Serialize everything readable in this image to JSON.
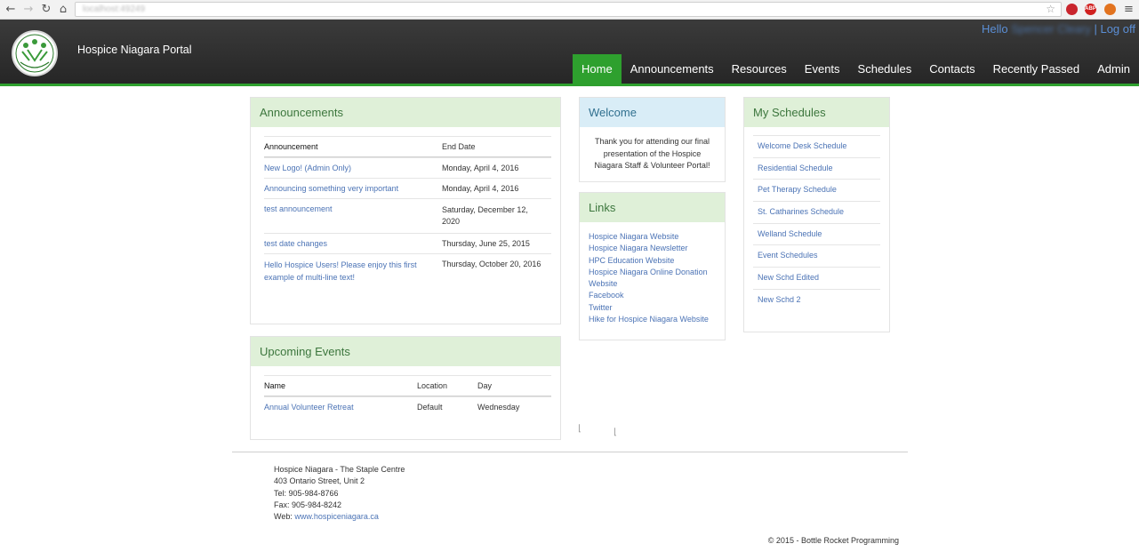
{
  "browser": {
    "url": "localhost:49249",
    "back": "←",
    "forward": "→",
    "reload": "↻",
    "home": "⌂",
    "star": "☆",
    "ext_abp": "ABP",
    "menu": "≡"
  },
  "header": {
    "site_title": "Hospice Niagara Portal",
    "hello_prefix": "Hello",
    "hello_user": "Spencer Cleary",
    "separator": "|",
    "logoff": "Log off",
    "accent": "#2ea02e"
  },
  "nav": [
    {
      "label": "Home",
      "active": true
    },
    {
      "label": "Announcements"
    },
    {
      "label": "Resources"
    },
    {
      "label": "Events"
    },
    {
      "label": "Schedules"
    },
    {
      "label": "Contacts"
    },
    {
      "label": "Recently Passed"
    },
    {
      "label": "Admin"
    }
  ],
  "announcements": {
    "title": "Announcements",
    "col_announcement": "Announcement",
    "col_end_date": "End Date",
    "rows": [
      {
        "title": "New Logo! (Admin Only)",
        "end": "Monday, April 4, 2016"
      },
      {
        "title": "Announcing something very important",
        "end": "Monday, April 4, 2016"
      },
      {
        "title": "test announcement",
        "end": "Saturday, December 12, 2020"
      },
      {
        "title": "test date changes",
        "end": "Thursday, June 25, 2015"
      },
      {
        "title": "Hello Hospice Users! Please enjoy this first example of multi-line text!",
        "end": "Thursday, October 20, 2016"
      }
    ]
  },
  "events": {
    "title": "Upcoming Events",
    "col_name": "Name",
    "col_location": "Location",
    "col_day": "Day",
    "rows": [
      {
        "name": "Annual Volunteer Retreat",
        "location": "Default",
        "day": "Wednesday"
      }
    ]
  },
  "welcome": {
    "title": "Welcome",
    "text": "Thank you for attending our final presentation of the Hospice Niagara Staff & Volunteer Portal!"
  },
  "links": {
    "title": "Links",
    "items": [
      "Hospice Niagara Website",
      "Hospice Niagara Newsletter",
      "HPC Education Website",
      "Hospice Niagara Online Donation Website",
      "Facebook",
      "Twitter",
      "Hike for Hospice Niagara Website"
    ]
  },
  "schedules": {
    "title": "My Schedules",
    "items": [
      "Welcome Desk Schedule",
      "Residential Schedule",
      "Pet Therapy Schedule",
      "St. Catharines Schedule",
      "Welland Schedule",
      "Event Schedules",
      "New Schd Edited",
      "New Schd 2"
    ]
  },
  "footer": {
    "org": "Hospice Niagara - The Staple Centre",
    "address": "403 Ontario Street, Unit 2",
    "tel": "Tel: 905-984-8766",
    "fax": "Fax: 905-984-8242",
    "web_label": "Web:",
    "web_link": "www.hospiceniagara.ca",
    "copyright": "© 2015 - Bottle Rocket Programming"
  }
}
